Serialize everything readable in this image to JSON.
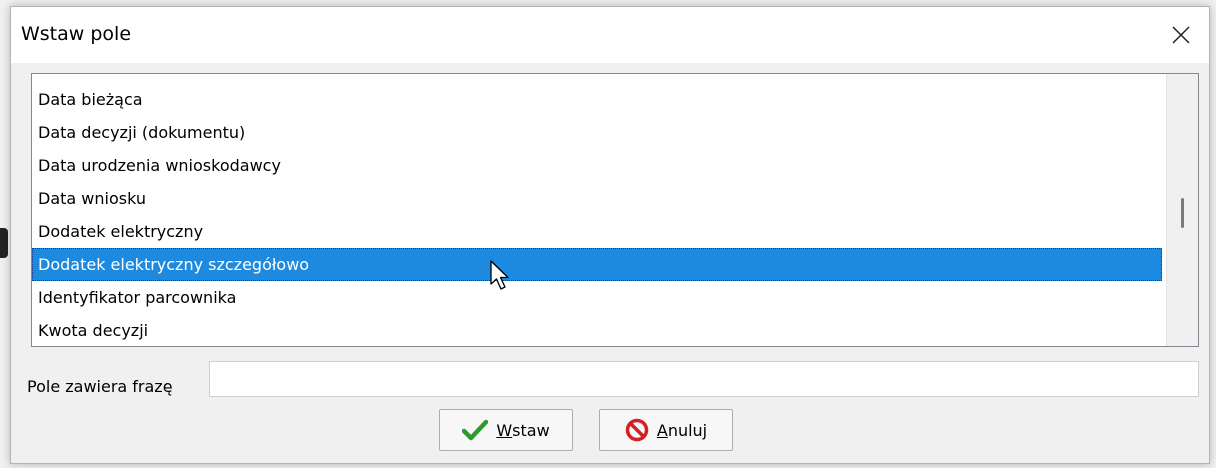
{
  "dialog": {
    "title": "Wstaw pole",
    "close_symbol": "✕"
  },
  "list": {
    "items": [
      {
        "label": "Data bieżąca",
        "selected": false
      },
      {
        "label": "Data decyzji (dokumentu)",
        "selected": false
      },
      {
        "label": "Data urodzenia wnioskodawcy",
        "selected": false
      },
      {
        "label": "Data wniosku",
        "selected": false
      },
      {
        "label": "Dodatek elektryczny",
        "selected": false
      },
      {
        "label": "Dodatek elektryczny szczegółowo",
        "selected": true
      },
      {
        "label": "Identyfikator parcownika",
        "selected": false
      },
      {
        "label": "Kwota decyzji",
        "selected": false
      }
    ]
  },
  "filter": {
    "label": "Pole zawiera frazę",
    "value": ""
  },
  "buttons": {
    "insert": {
      "accel": "W",
      "rest": "staw",
      "icon": "checkmark-icon"
    },
    "cancel": {
      "accel": "A",
      "rest": "nuluj",
      "icon": "no-entry-icon"
    }
  },
  "colors": {
    "selection": "#1e8adf",
    "check": "#2e9a2e",
    "cancel": "#d42020"
  }
}
